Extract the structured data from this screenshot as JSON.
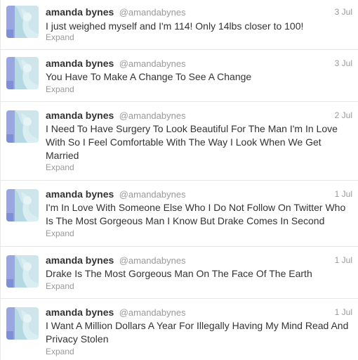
{
  "tweets": [
    {
      "name": "amanda bynes",
      "handle": "@amandabynes",
      "time": "3 Jul",
      "text": "I just weighed myself and I'm 114! Only 14lbs closer to 100!",
      "expand": "Expand"
    },
    {
      "name": "amanda bynes",
      "handle": "@amandabynes",
      "time": "3 Jul",
      "text": "You Have To Make A Change To See A Change",
      "expand": "Expand"
    },
    {
      "name": "amanda bynes",
      "handle": "@amandabynes",
      "time": "2 Jul",
      "text": "I Need To Have Surgery To Look Beautiful For The Man I'm In Love With So I Feel Comfortable With The Way I Look When We Get Married",
      "expand": "Expand"
    },
    {
      "name": "amanda bynes",
      "handle": "@amandabynes",
      "time": "1 Jul",
      "text": "I'm In Love With Someone Else Who I Do Not Follow On Twitter Who Is The Most Gorgeous Man I Know But Drake Comes In Second",
      "expand": "Expand"
    },
    {
      "name": "amanda bynes",
      "handle": "@amandabynes",
      "time": "1 Jul",
      "text": "Drake Is The Most Gorgeous Man On The Face Of The Earth",
      "expand": "Expand"
    },
    {
      "name": "amanda bynes",
      "handle": "@amandabynes",
      "time": "1 Jul",
      "text": "I Want A Million Dollars A Year For Illegally Having My Mind Read And Privacy Stolen",
      "expand": "Expand"
    }
  ]
}
